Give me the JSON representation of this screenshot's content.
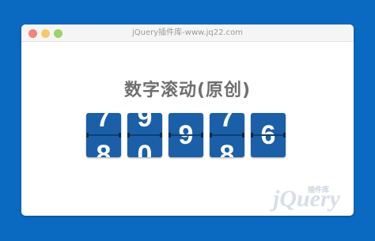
{
  "window": {
    "title": "jQuery插件库-www.jq22.com",
    "controls": {
      "close_color": "#f2857a",
      "minimize_color": "#f5c96b",
      "maximize_color": "#9bd36d"
    }
  },
  "page": {
    "heading": "数字滚动(原创)"
  },
  "counter": {
    "digits": [
      {
        "top": "7",
        "bottom": "8"
      },
      {
        "top": "9",
        "bottom": "0"
      },
      {
        "center": "9"
      },
      {
        "top": "7",
        "bottom": "8"
      },
      {
        "center": "6"
      }
    ],
    "tile_color": "#1a5fa8"
  },
  "watermark": {
    "text": "jQuery",
    "sub": "插件库"
  },
  "colors": {
    "background": "#0a69c0",
    "heading": "#6f6f6f"
  }
}
